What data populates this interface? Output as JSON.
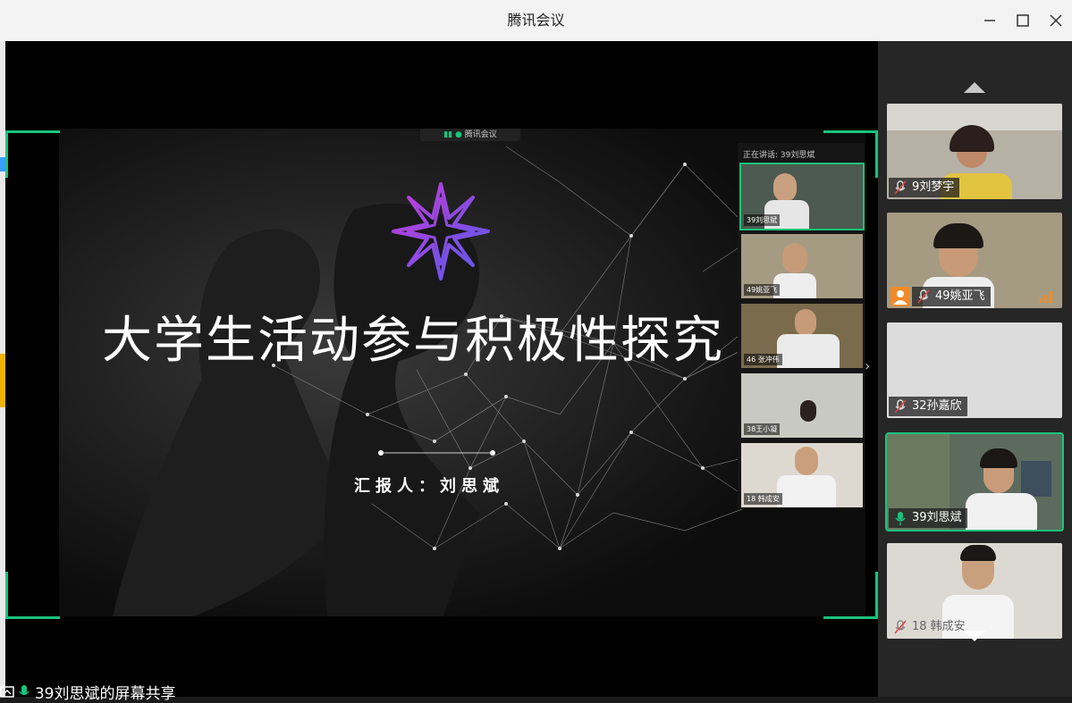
{
  "window": {
    "title": "腾讯会议",
    "minimize_icon": "minimize-icon",
    "maximize_icon": "maximize-icon",
    "close_icon": "close-icon"
  },
  "slide": {
    "badge": "腾讯会议",
    "title": "大学生活动参与积极性探究",
    "presenter": "汇报人：刘思斌",
    "logo_icon": "star-logo-icon"
  },
  "inner_panel": {
    "speaking": "正在讲话: 39刘思斌",
    "tiles": [
      {
        "label": "39刘思斌"
      },
      {
        "label": "49姚亚飞"
      },
      {
        "label": "46 张冲伟"
      },
      {
        "label": "38王小凝"
      },
      {
        "label": "18 韩成安"
      }
    ]
  },
  "sidebar": {
    "tiles": [
      {
        "name": "9刘梦宇",
        "muted": true,
        "bg": "#b8b3a6"
      },
      {
        "name": "49姚亚飞",
        "muted": true,
        "bg": "#a89c82"
      },
      {
        "name": "32孙嘉欣",
        "muted": true,
        "bg": "#dcdcdc"
      },
      {
        "name": "39刘思斌",
        "muted": false,
        "bg": "#5b6a5d"
      },
      {
        "name": "18 韩成安",
        "muted": true,
        "bg": "#d9d9d3"
      }
    ]
  },
  "status": {
    "share_text": "39刘思斌的屏幕共享"
  },
  "colors": {
    "accent": "#19c37d",
    "avatar_orange": "#f28a28"
  }
}
